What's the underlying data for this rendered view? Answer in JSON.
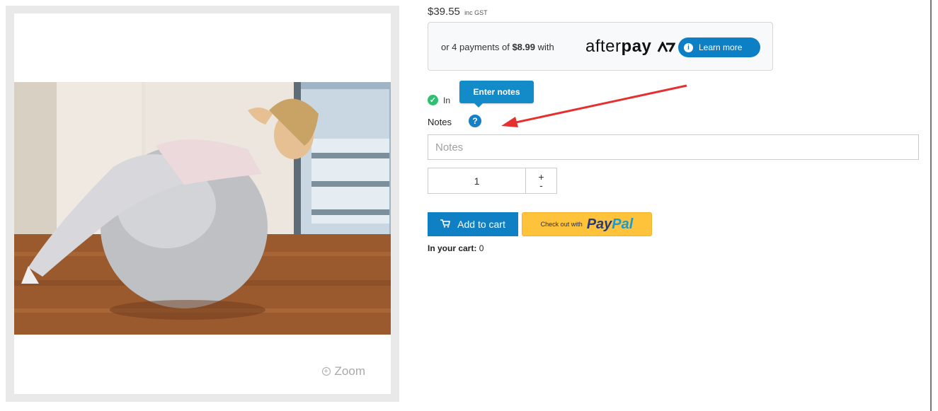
{
  "price": {
    "amount": "$39.55",
    "suffix": "inc GST"
  },
  "afterpay": {
    "prefix": "or 4 payments of",
    "installment": "$8.99",
    "with": "with",
    "logo_a": "after",
    "logo_b": "pay",
    "learn_more": "Learn more"
  },
  "stock": {
    "label": "In"
  },
  "tooltip": {
    "text": "Enter notes"
  },
  "notes": {
    "label": "Notes",
    "placeholder": "Notes",
    "value": ""
  },
  "quantity": {
    "value": "1",
    "plus": "+",
    "minus": "-"
  },
  "buttons": {
    "add_to_cart": "Add to cart",
    "paypal_prefix": "Check out with",
    "paypal_logo_a": "Pay",
    "paypal_logo_b": "Pal"
  },
  "cart": {
    "label": "In your cart:",
    "count": "0"
  },
  "gallery": {
    "zoom_label": "Zoom"
  },
  "colors": {
    "accent": "#0f80c3",
    "paypal_bg": "#fec33b",
    "arrow": "#e53030",
    "stock_ok": "#2fbf71"
  },
  "icons": [
    "zoom-icon",
    "info-icon",
    "check-icon",
    "help-icon",
    "cart-icon",
    "arrow-annotation"
  ]
}
